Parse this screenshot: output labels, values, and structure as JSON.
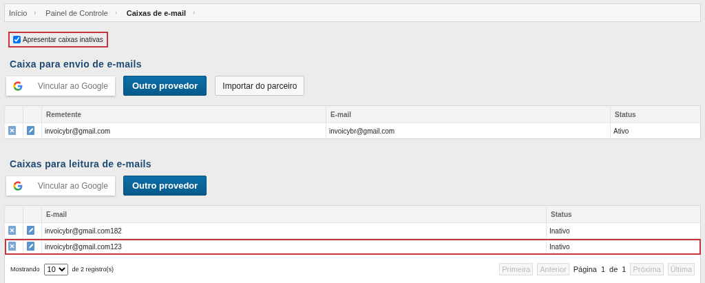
{
  "breadcrumb": [
    {
      "label": "Início",
      "selected": false
    },
    {
      "label": "Painel de Controle",
      "selected": false
    },
    {
      "label": "Caixas de e-mail",
      "selected": true
    }
  ],
  "show_inactive": {
    "label": "Apresentar caixas inativas",
    "checked": true,
    "highlighted": true
  },
  "sending": {
    "title": "Caixa para envio de e-mails",
    "buttons": [
      {
        "kind": "google",
        "label": "Vincular ao Google"
      },
      {
        "kind": "primary",
        "label": "Outro provedor"
      },
      {
        "kind": "secondary",
        "label": "Importar do parceiro"
      }
    ],
    "table": {
      "columns": [
        "Remetente",
        "E-mail",
        "Status"
      ],
      "rows": [
        {
          "cells": [
            "invoicybr@gmail.com",
            "invoicybr@gmail.com",
            "Ativo"
          ],
          "highlighted": false
        }
      ]
    }
  },
  "reading": {
    "title": "Caixas para leitura de e-mails",
    "buttons": [
      {
        "kind": "google",
        "label": "Vincular ao Google"
      },
      {
        "kind": "primary",
        "label": "Outro provedor"
      }
    ],
    "table": {
      "columns": [
        "E-mail",
        "Status"
      ],
      "rows": [
        {
          "cells": [
            "invoicybr@gmail.com182",
            "Inativo"
          ],
          "highlighted": false
        },
        {
          "cells": [
            "invoicybr@gmail.com123",
            "Inativo"
          ],
          "highlighted": true
        }
      ]
    },
    "footer": {
      "showing_label": "Mostrando",
      "page_size": "10",
      "records": "de  2 registro(s)",
      "pager": [
        {
          "label": "Primeira",
          "disabled": true
        },
        {
          "label": "Anterior",
          "disabled": true
        }
      ],
      "page_label": "Página",
      "page": "1",
      "of_label": "de",
      "pages": "1",
      "pager_end": [
        {
          "label": "Próxima",
          "disabled": true
        },
        {
          "label": "Última",
          "disabled": true
        }
      ]
    }
  }
}
